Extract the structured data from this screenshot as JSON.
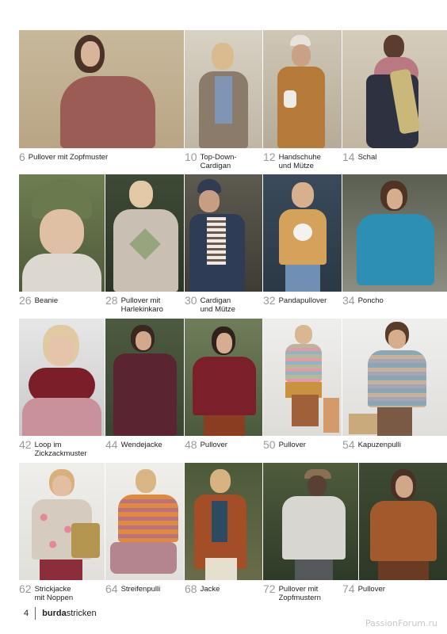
{
  "items": [
    {
      "num": "6",
      "lines": [
        "Pullover mit Zopfmuster"
      ],
      "image": "woman-cable-pullover-photo"
    },
    {
      "num": "10",
      "lines": [
        "Top-Down-",
        "Cardigan"
      ],
      "image": "woman-cardigan-photo"
    },
    {
      "num": "12",
      "lines": [
        "Handschuhe",
        "und Mütze"
      ],
      "image": "woman-coat-gloves-photo"
    },
    {
      "num": "14",
      "lines": [
        "Schal"
      ],
      "image": "woman-scarf-photo"
    },
    {
      "num": "26",
      "lines": [
        "Beanie"
      ],
      "image": "woman-beanie-photo"
    },
    {
      "num": "28",
      "lines": [
        "Pullover mit",
        "Harlekinkaro"
      ],
      "image": "woman-argyle-pullover-photo"
    },
    {
      "num": "30",
      "lines": [
        "Cardigan",
        "und Mütze"
      ],
      "image": "boy-cardigan-photo"
    },
    {
      "num": "32",
      "lines": [
        "Pandapullover"
      ],
      "image": "girl-panda-pullover-photo"
    },
    {
      "num": "34",
      "lines": [
        "Poncho"
      ],
      "image": "woman-poncho-photo"
    },
    {
      "num": "42",
      "lines": [
        "Loop im",
        "Zickzackmuster"
      ],
      "image": "woman-loop-scarf-photo"
    },
    {
      "num": "44",
      "lines": [
        "Wendejacke"
      ],
      "image": "woman-jacket-photo"
    },
    {
      "num": "48",
      "lines": [
        "Pullover"
      ],
      "image": "woman-red-pullover-photo"
    },
    {
      "num": "50",
      "lines": [
        "Pullover"
      ],
      "image": "girl-striped-pullover-photo"
    },
    {
      "num": "54",
      "lines": [
        "Kapuzenpulli"
      ],
      "image": "boy-hoodie-photo"
    },
    {
      "num": "62",
      "lines": [
        "Strickjacke",
        "mit Noppen"
      ],
      "image": "girl-bobble-cardigan-photo"
    },
    {
      "num": "64",
      "lines": [
        "Streifenpulli"
      ],
      "image": "woman-striped-pullover-photo"
    },
    {
      "num": "68",
      "lines": [
        "Jacke"
      ],
      "image": "woman-long-jacket-photo"
    },
    {
      "num": "72",
      "lines": [
        "Pullover mit",
        "Zopfmustern"
      ],
      "image": "woman-cable-sweater-photo"
    },
    {
      "num": "74",
      "lines": [
        "Pullover"
      ],
      "image": "woman-brown-pullover-photo"
    }
  ],
  "footer": {
    "page": "4",
    "brand_bold": "burda",
    "brand_rest": "stricken"
  },
  "watermark": "PassionForum.ru",
  "colors": {
    "caption_number": "#9a9a9a",
    "caption_text": "#222222"
  }
}
